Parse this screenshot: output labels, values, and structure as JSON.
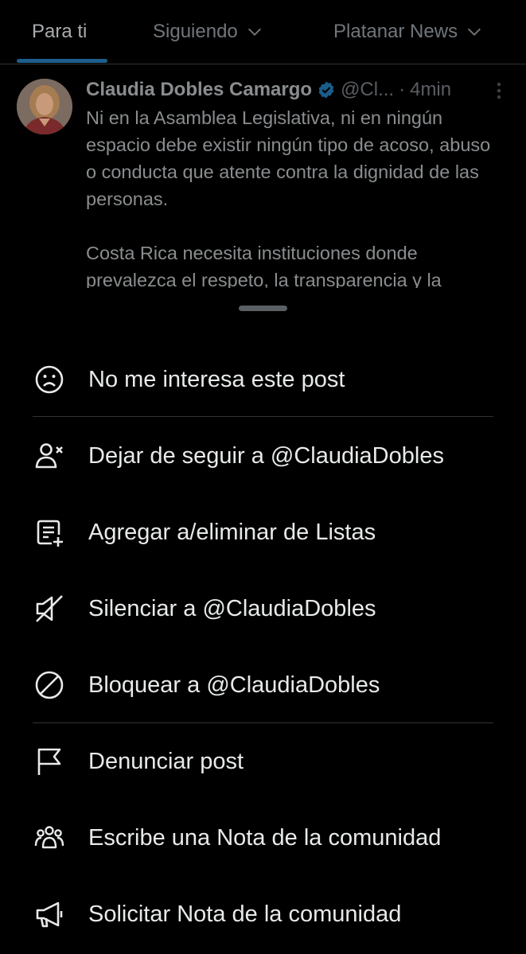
{
  "tabs": [
    {
      "label": "Para ti",
      "active": true,
      "dropdown": false
    },
    {
      "label": "Siguiendo",
      "active": false,
      "dropdown": true
    },
    {
      "label": "Platanar News",
      "active": false,
      "dropdown": true
    }
  ],
  "tweet": {
    "author_name": "Claudia Dobles Camargo",
    "verified": true,
    "handle": "@Cl...",
    "dot": "·",
    "time": "4min",
    "paragraph_1": "Ni en la Asamblea Legislativa, ni en ningún espacio debe existir ningún tipo de acoso, abuso o conducta que atente contra la dignidad de las personas.",
    "paragraph_2": "Costa Rica necesita instituciones donde prevalezca el respeto, la transparencia y la"
  },
  "menu": {
    "not_interested": "No me interesa este post",
    "unfollow": "Dejar de seguir a @ClaudiaDobles",
    "lists": "Agregar a/eliminar de Listas",
    "mute": "Silenciar a @ClaudiaDobles",
    "block": "Bloquear a @ClaudiaDobles",
    "report": "Denunciar post",
    "write_note": "Escribe una Nota de la comunidad",
    "request_note": "Solicitar Nota de la comunidad"
  },
  "colors": {
    "background": "#000000",
    "text": "#e7e9ea",
    "muted": "#71767b",
    "divider": "#2f3336",
    "accent": "#1d9bf0"
  }
}
